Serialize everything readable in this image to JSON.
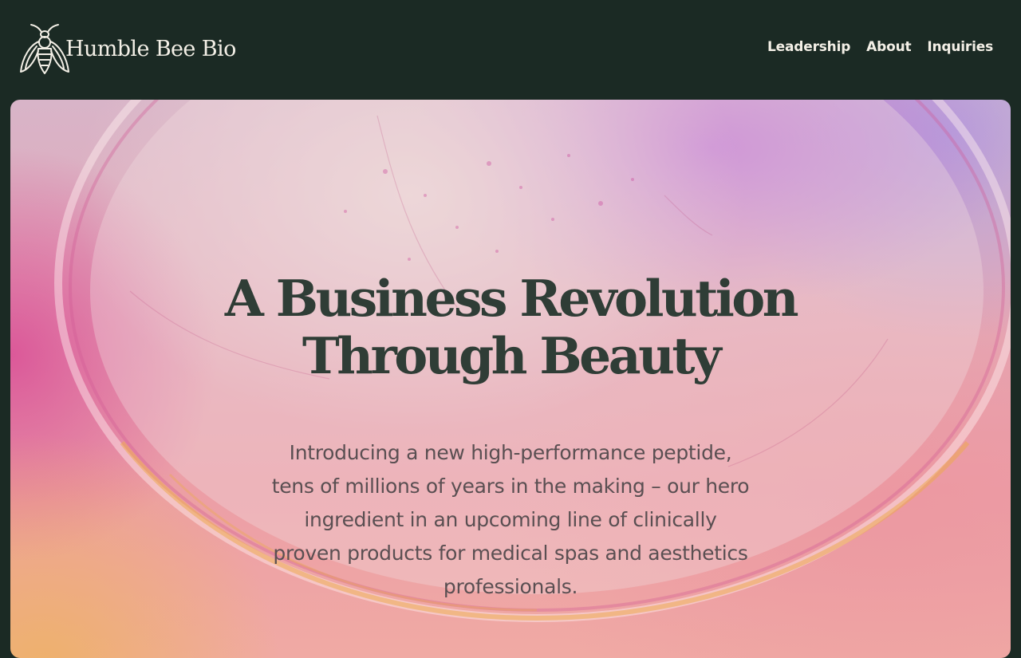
{
  "brand": {
    "name": "Humble Bee Bio",
    "logo_icon": "bee-icon"
  },
  "nav": {
    "items": [
      {
        "label": "Leadership"
      },
      {
        "label": "About"
      },
      {
        "label": "Inquiries"
      }
    ]
  },
  "hero": {
    "title_line1": "A Business Revolution",
    "title_line2": "Through Beauty",
    "subtitle": "Introducing a new high-performance peptide, tens of millions of years in the making – our hero ingredient in an upcoming line of clinically proven products for medical spas and aesthetics professionals.",
    "colors": {
      "header_bg": "#1b2a24",
      "title": "#2f3d36",
      "subtitle": "#5a4f52",
      "accent_pink": "#da5096",
      "accent_purple": "#b968d6",
      "accent_orange": "#eeb264"
    }
  }
}
